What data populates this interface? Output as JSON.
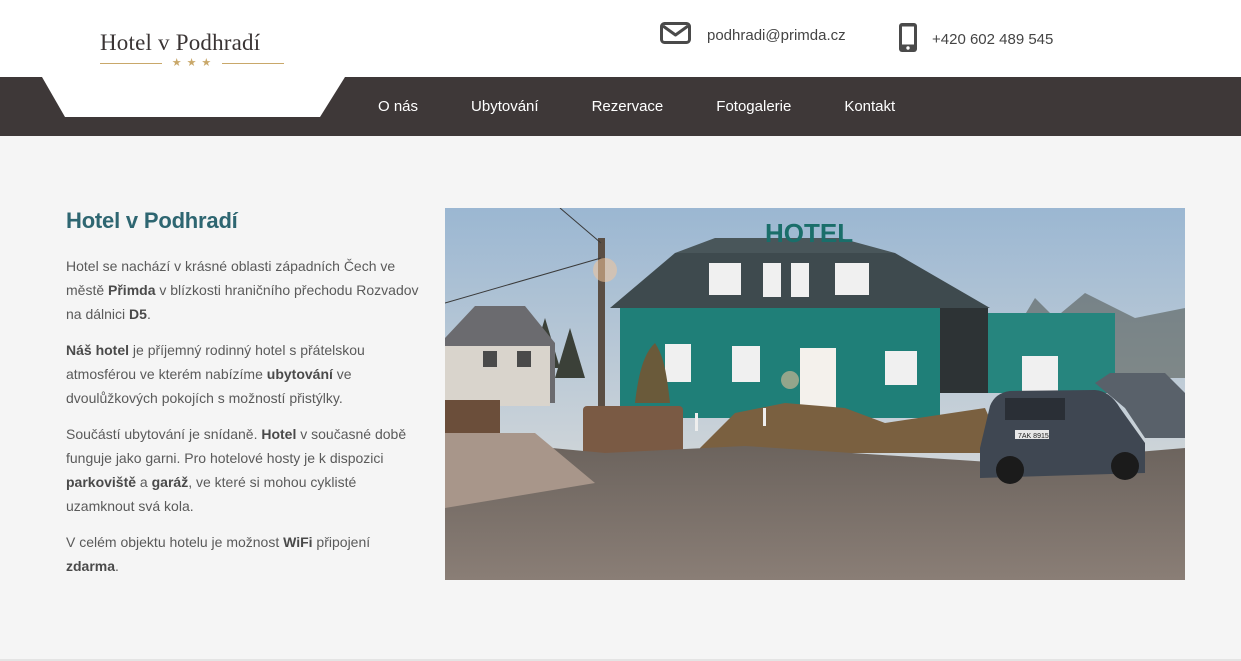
{
  "brand": {
    "name": "Hotel v Podhradí",
    "stars": "★★★"
  },
  "contact": {
    "email": "podhradi@primda.cz",
    "phone": "+420 602 489 545",
    "email_icon": "envelope-icon",
    "phone_icon": "phone-icon"
  },
  "nav": [
    "O nás",
    "Ubytování",
    "Rezervace",
    "Fotogalerie",
    "Kontakt"
  ],
  "main": {
    "title": "Hotel v Podhradí",
    "p1": {
      "a": "Hotel se nachází v krásné oblasti západních Čech ve městě ",
      "b1": "Přimda",
      "c": " v blízkosti hraničního přechodu Rozvadov na dálnici ",
      "b2": "D5",
      "d": "."
    },
    "p2": {
      "b1": "Náš hotel",
      "a": " je příjemný rodinný hotel s přátelskou atmosférou ve kterém nabízíme ",
      "b2": "ubytování",
      "c": " ve dvoulůžkových pokojích s možností přistýlky."
    },
    "p3": {
      "a": "Součástí ubytování je snídaně. ",
      "b1": "Hotel",
      "c": " v současné době funguje jako garni. Pro hotelové hosty je k dispozici ",
      "b2": "parkoviště",
      "d": " a ",
      "b3": "garáž",
      "e": ", ve které si mohou cyklisté uzamknout svá kola."
    },
    "p4": {
      "a": "V celém objektu hotelu je možnost ",
      "b1": "WiFi",
      "c": " připojení ",
      "b2": "zdarma",
      "d": "."
    }
  },
  "photo": {
    "sign": "HOTEL",
    "plate": "7AK 8915"
  },
  "colors": {
    "nav_bg": "#3e3838",
    "title": "#2e6671",
    "gold": "#c9a86a",
    "facade": "#1f7f78"
  }
}
